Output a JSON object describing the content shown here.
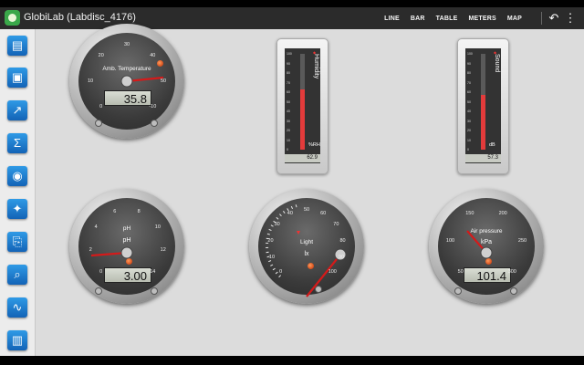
{
  "app": {
    "title": "GlobiLab (Labdisc_4176)"
  },
  "menu": [
    "LINE",
    "BAR",
    "TABLE",
    "METERS",
    "MAP"
  ],
  "icons": {
    "undo": "undo-icon",
    "more": "more-vertical-icon",
    "toolbar": [
      "open-folder-icon",
      "save-icon",
      "export-icon",
      "sigma-icon",
      "labdisc-icon",
      "run-icon",
      "edit-page-icon",
      "zoom-icon",
      "graph-icon",
      "book-icon"
    ]
  },
  "colors": {
    "accent": "#1a73c8",
    "needle": "#d41a1a",
    "bar": "#e33b3b",
    "scale_green": "#4caf50",
    "scale_red": "#d32f2f",
    "scale_blue": "#3b44c8"
  },
  "gauges": [
    {
      "title": "Amb. Temperature",
      "unit": "°C",
      "value": "35.8",
      "ticks": [
        "0",
        "10",
        "20",
        "30",
        "40",
        "50",
        "-10"
      ],
      "pointer_value": 35.8,
      "min": -10,
      "max": 50
    },
    {
      "title": "pH",
      "unit": "pH",
      "value": "3.00",
      "ticks": [
        "0",
        "2",
        "4",
        "6",
        "8",
        "10",
        "12",
        "14"
      ],
      "pointer_value": 3.0,
      "min": 0,
      "max": 14
    },
    {
      "title": "Light",
      "unit": "lx",
      "value": "",
      "ticks": [
        "0",
        "10",
        "20",
        "30",
        "40",
        "50",
        "60",
        "70",
        "80",
        "90",
        "100"
      ],
      "pointer_value": 0,
      "min": 0,
      "max": 600
    },
    {
      "title": "Air pressure",
      "unit": "kPa",
      "value": "101.4",
      "ticks": [
        "50",
        "100",
        "150",
        "200",
        "250",
        "300"
      ],
      "pointer_value": 101.4,
      "min": 0,
      "max": 300
    }
  ],
  "bars": [
    {
      "title": "Humidity",
      "unit": "%RH",
      "value": "62.9",
      "fraction": 0.629,
      "ticks": [
        "100",
        "90",
        "80",
        "70",
        "60",
        "50",
        "40",
        "30",
        "20",
        "10",
        "0"
      ]
    },
    {
      "title": "Sound",
      "unit": "dB",
      "value": "57.3",
      "fraction": 0.573,
      "ticks": [
        "100",
        "90",
        "80",
        "70",
        "60",
        "50",
        "40",
        "30",
        "20",
        "10",
        "0"
      ]
    }
  ]
}
